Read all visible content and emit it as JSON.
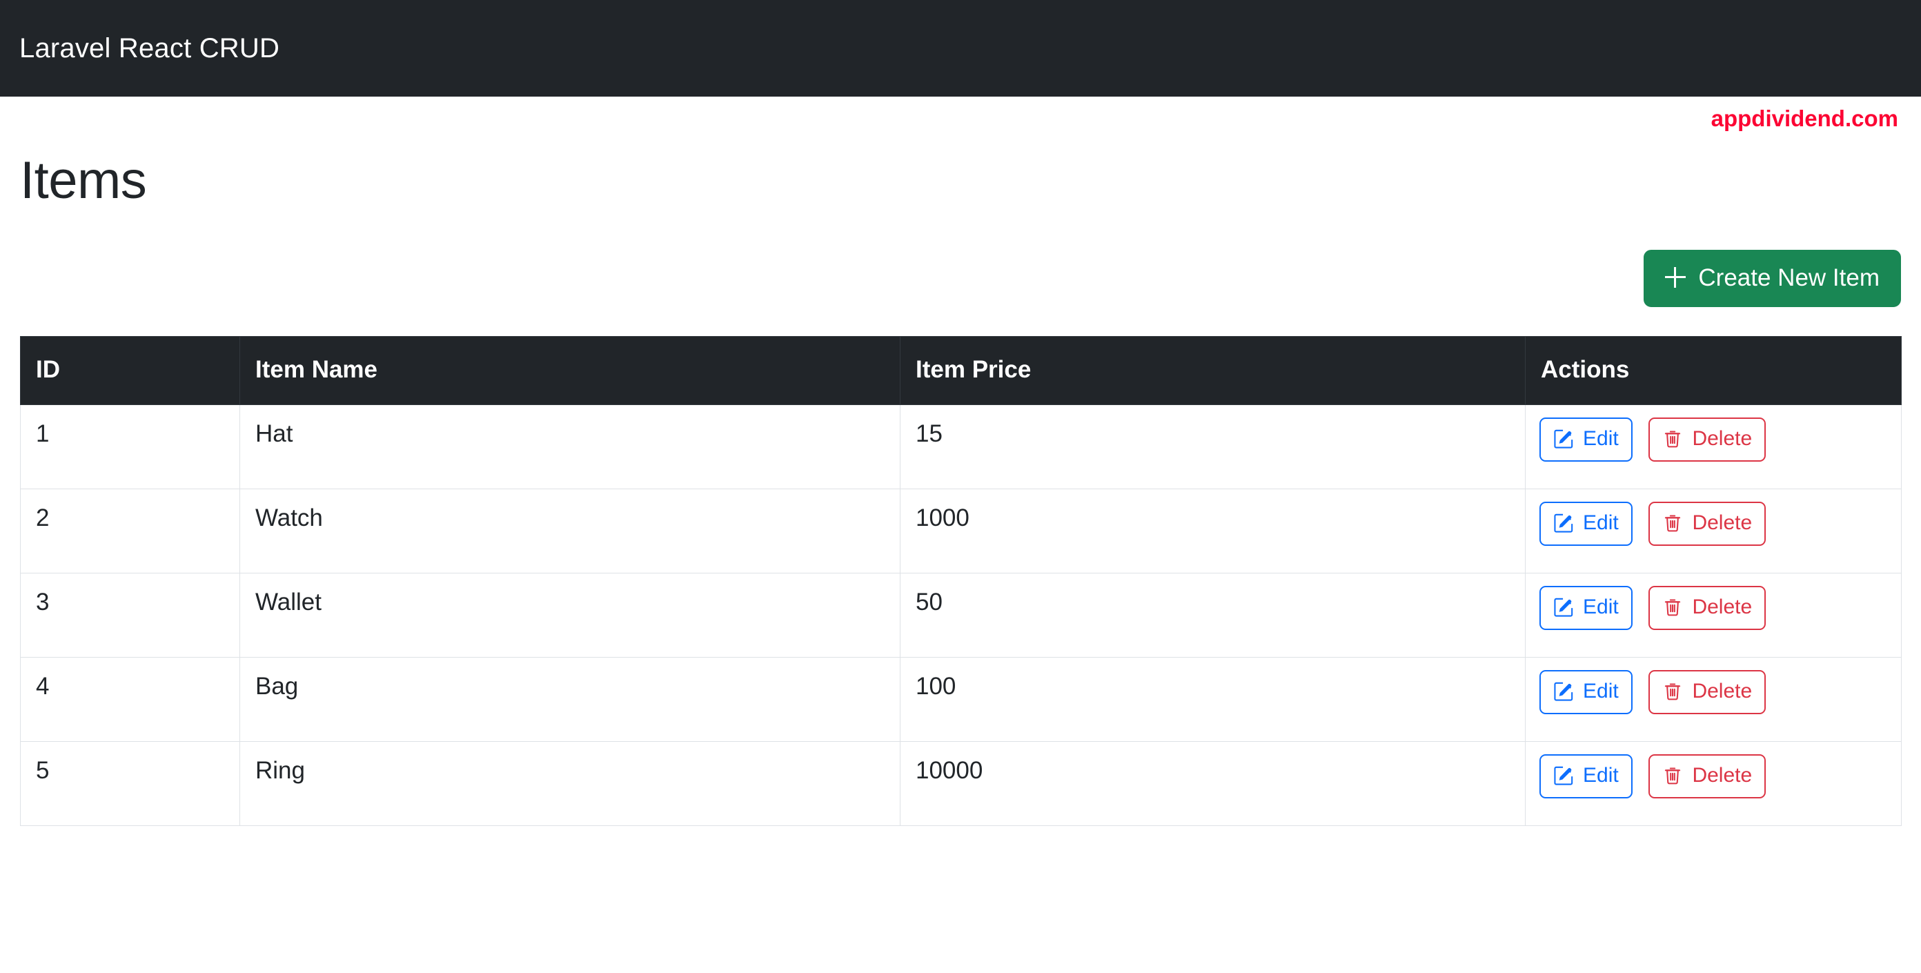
{
  "navbar": {
    "brand": "Laravel React CRUD",
    "background_color": "#212529",
    "text_color": "#ffffff"
  },
  "watermark": {
    "text": "appdividend.com",
    "color": "#fc0433"
  },
  "page": {
    "title": "Items"
  },
  "toolbar": {
    "create_label": "Create New Item",
    "create_icon": "plus-icon",
    "create_color": "#198754"
  },
  "table": {
    "columns": [
      "ID",
      "Item Name",
      "Item Price",
      "Actions"
    ],
    "row_actions": {
      "edit_label": "Edit",
      "edit_icon": "pencil-square-icon",
      "edit_color": "#0d6efd",
      "delete_label": "Delete",
      "delete_icon": "trash-icon",
      "delete_color": "#dc3545"
    },
    "rows": [
      {
        "id": "1",
        "name": "Hat",
        "price": "15"
      },
      {
        "id": "2",
        "name": "Watch",
        "price": "1000"
      },
      {
        "id": "3",
        "name": "Wallet",
        "price": "50"
      },
      {
        "id": "4",
        "name": "Bag",
        "price": "100"
      },
      {
        "id": "5",
        "name": "Ring",
        "price": "10000"
      }
    ]
  }
}
